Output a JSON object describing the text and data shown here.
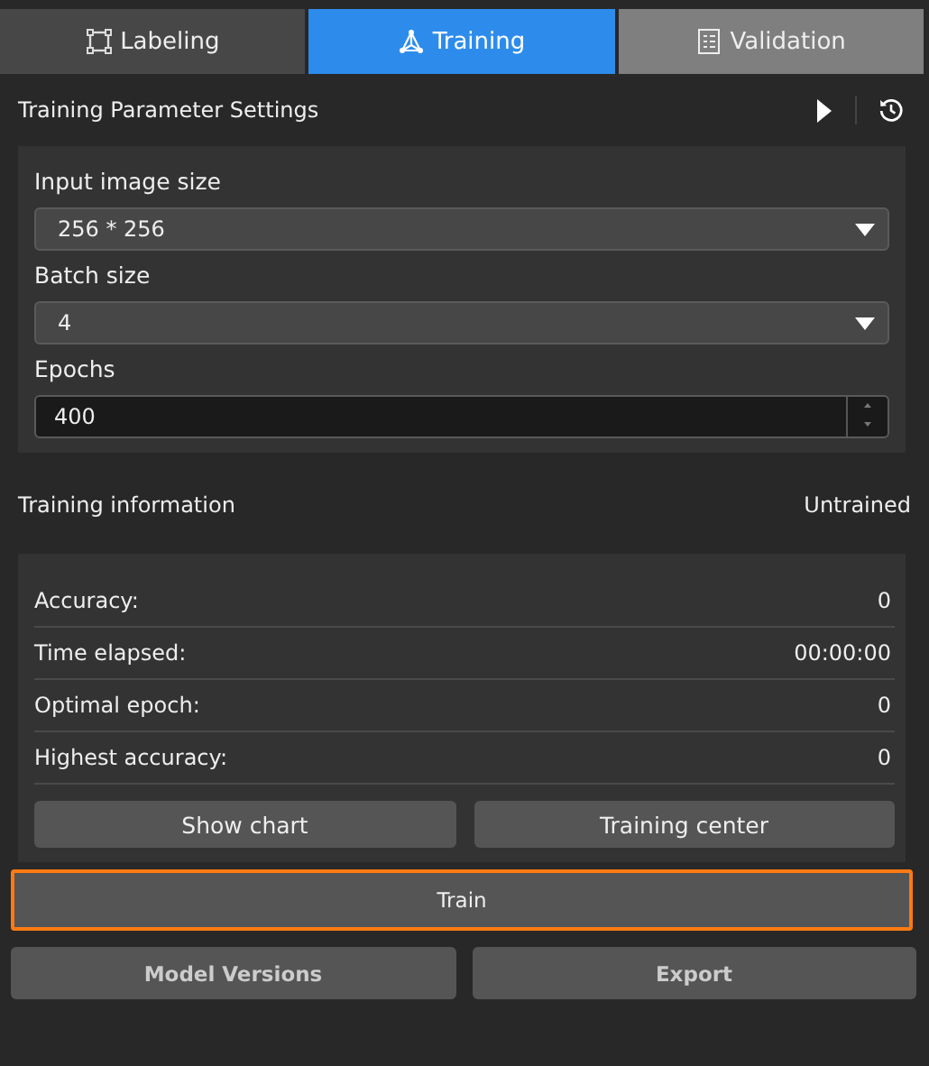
{
  "tabs": [
    {
      "label": "Labeling",
      "selected": false,
      "disabled": false
    },
    {
      "label": "Training",
      "selected": true,
      "disabled": false
    },
    {
      "label": "Validation",
      "selected": false,
      "disabled": true
    }
  ],
  "parameters": {
    "title": "Training Parameter Settings",
    "fields": [
      {
        "kind": "dropdown",
        "label": "Input image size",
        "value": "256 * 256"
      },
      {
        "kind": "dropdown",
        "label": "Batch size",
        "value": "4"
      },
      {
        "kind": "spinbox",
        "label": "Epochs",
        "value": "400"
      }
    ]
  },
  "information": {
    "title": "Training information",
    "status": "Untrained",
    "rows": [
      {
        "label": "Accuracy:",
        "value": "0"
      },
      {
        "label": "Time elapsed:",
        "value": "00:00:00"
      },
      {
        "label": "Optimal epoch:",
        "value": "0"
      },
      {
        "label": "Highest accuracy:",
        "value": "0"
      }
    ],
    "buttons": [
      "Show chart",
      "Training center"
    ]
  },
  "train_button": {
    "label": "Train",
    "focused": true
  },
  "bottom_buttons": [
    "Model Versions",
    "Export"
  ]
}
